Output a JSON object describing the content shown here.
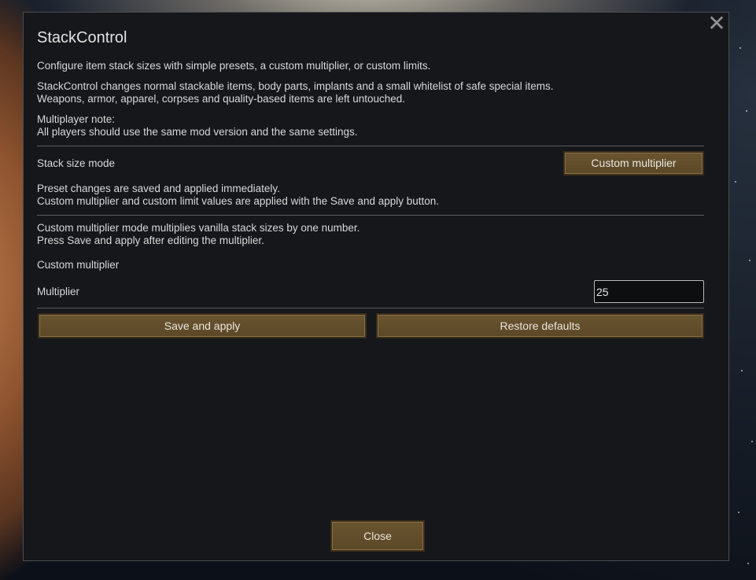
{
  "dialog": {
    "title": "StackControl",
    "intro": "Configure item stack sizes with simple presets, a custom multiplier, or custom limits.",
    "description_line1": "StackControl changes normal stackable items, body parts, implants and a small whitelist of safe special items.",
    "description_line2": "Weapons, armor, apparel, corpses and quality-based items are left untouched.",
    "mp_note_title": "Multiplayer note:",
    "mp_note_text": "All players should use the same mod version and the same settings.",
    "mode_label": "Stack size mode",
    "mode_button": "Custom multiplier",
    "preset_note_line1": "Preset changes are saved and applied immediately.",
    "preset_note_line2": "Custom multiplier and custom limit values are applied with the Save and apply button.",
    "custom_note_line1": "Custom multiplier mode multiplies vanilla stack sizes by one number.",
    "custom_note_line2": "Press Save and apply after editing the multiplier.",
    "section_label": "Custom multiplier",
    "multiplier_label": "Multiplier",
    "multiplier_value": "25",
    "save_button": "Save and apply",
    "restore_button": "Restore defaults",
    "close_button": "Close",
    "close_icon": "close-icon"
  }
}
